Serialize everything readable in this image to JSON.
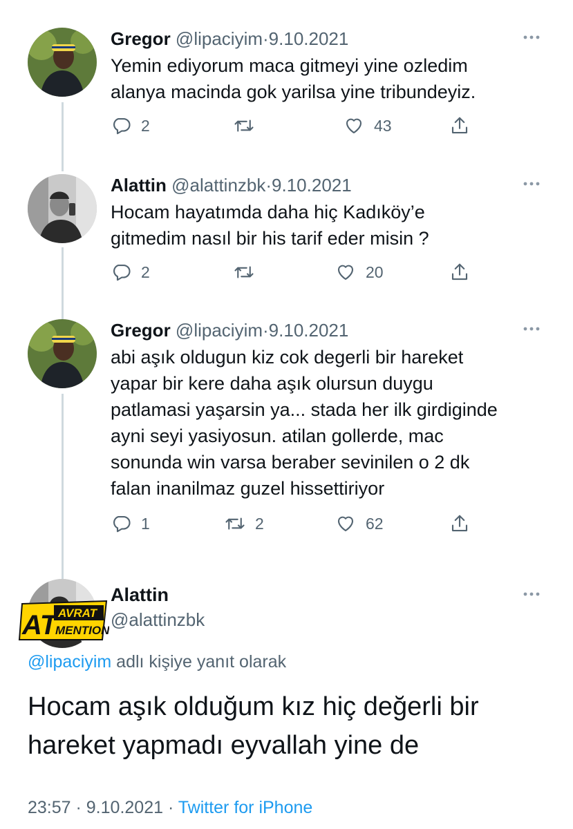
{
  "thread": [
    {
      "name": "Gregor",
      "handle": "@lipaciyim",
      "separator": "·",
      "date": "9.10.2021",
      "lines": [
        "Yemin ediyorum maca gitmeyi yine ozledim",
        "alanya macinda gok yarilsa yine tribundeyiz."
      ],
      "replies": "2",
      "retweets": "",
      "likes": "43"
    },
    {
      "name": "Alattin",
      "handle": "@alattinzbk",
      "separator": "·",
      "date": "9.10.2021",
      "lines": [
        "Hocam hayatımda daha hiç Kadıköy’e",
        "gitmedim nasıl bir his tarif eder misin ?"
      ],
      "replies": "2",
      "retweets": "",
      "likes": "20"
    },
    {
      "name": "Gregor",
      "handle": "@lipaciyim",
      "separator": "·",
      "date": "9.10.2021",
      "lines": [
        "abi aşık oldugun kiz cok degerli bir hareket",
        "yapar bir kere daha aşık olursun duygu",
        "patlamasi yaşarsin ya... stada her ilk girdiginde",
        "ayni seyi yasiyosun. atilan gollerde, mac",
        "sonunda win varsa beraber sevinilen o 2 dk",
        "falan inanilmaz guzel hissettiriyor"
      ],
      "replies": "1",
      "retweets": "2",
      "likes": "62"
    }
  ],
  "main_tweet": {
    "name": "Alattin",
    "handle": "@alattinzbk",
    "reply_mention": "@lipaciyim",
    "reply_suffix": " adlı kişiye yanıt olarak",
    "lines": [
      "Hocam aşık olduğum kız hiç değerli bir",
      "hareket yapmadı eyvallah yine de"
    ],
    "time": "23:57",
    "separator": " · ",
    "date": "9.10.2021",
    "source": "Twitter for iPhone"
  },
  "watermark": {
    "big": "AT",
    "line1": "AVRAT",
    "line2": "MENTION"
  },
  "icons": {
    "reply": "reply-icon",
    "retweet": "retweet-icon",
    "like": "heart-icon",
    "share": "share-icon",
    "more": "more-icon"
  },
  "colors": {
    "text": "#0f1419",
    "secondary": "#536471",
    "link": "#1d9bf0",
    "thread_line": "#cfd9de",
    "watermark_yellow": "#ffd400"
  }
}
